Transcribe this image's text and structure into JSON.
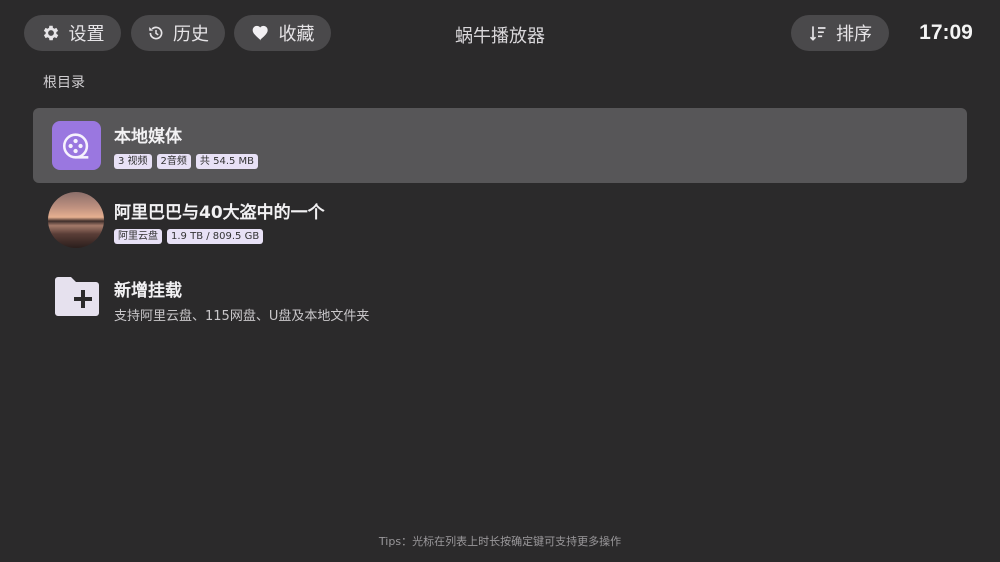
{
  "header": {
    "settings_label": "设置",
    "history_label": "历史",
    "favorites_label": "收藏",
    "app_title": "蜗牛播放器",
    "sort_label": "排序",
    "clock": "17:09"
  },
  "breadcrumb": "根目录",
  "items": [
    {
      "title": "本地媒体",
      "badges": [
        "3 视频",
        "2音频",
        "共 54.5 MB"
      ],
      "icon": "video-reel-icon",
      "selected": true
    },
    {
      "title": "阿里巴巴与40大盗中的一个",
      "badges": [
        "阿里云盘",
        "1.9 TB / 809.5 GB"
      ],
      "icon": "sunset-avatar",
      "selected": false
    },
    {
      "title": "新增挂载",
      "subtitle": "支持阿里云盘、115网盘、U盘及本地文件夹",
      "icon": "add-folder-icon",
      "selected": false
    }
  ],
  "tips": "Tips：光标在列表上时长按确定键可支持更多操作",
  "colors": {
    "background": "#2b2a2b",
    "pill": "#4a494b",
    "selected_row": "#575658",
    "accent_purple": "#9a77e0",
    "badge_bg": "#e8e1f6"
  }
}
